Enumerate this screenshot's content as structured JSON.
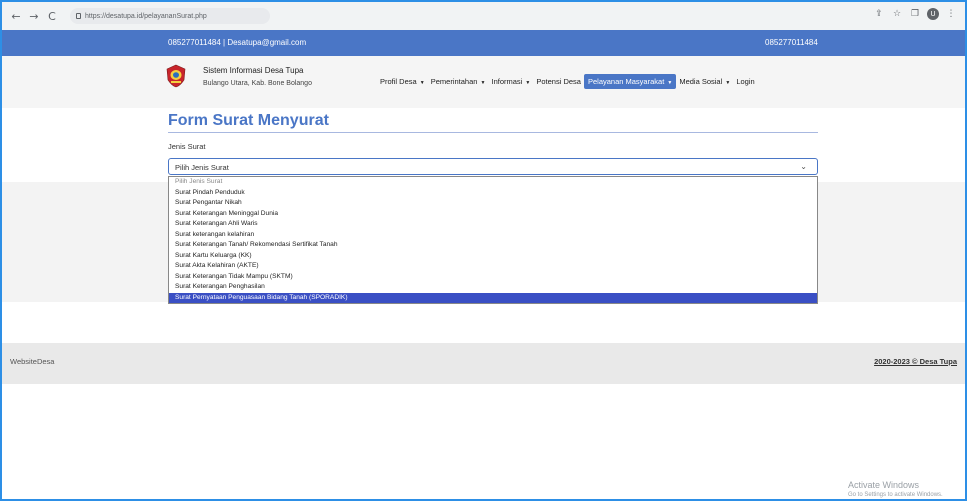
{
  "browser": {
    "url": "https://desatupa.id/pelayananSurat.php",
    "back": "←",
    "forward": "→",
    "reload": "C",
    "share_icon": "⇪",
    "star_icon": "☆",
    "window_icon": "❐",
    "profile_initial": "U",
    "more_icon": "⋮"
  },
  "topbar": {
    "contact": "085277011484 | Desatupa@gmail.com",
    "phone": "085277011484"
  },
  "header": {
    "title": "Sistem Informasi Desa Tupa",
    "subtitle": "Bulango Utara, Kab. Bone Bolango"
  },
  "menu": [
    {
      "label": "Profil Desa",
      "caret": "▼",
      "active": false
    },
    {
      "label": "Pemerintahan",
      "caret": "▼",
      "active": false
    },
    {
      "label": "Informasi",
      "caret": "▼",
      "active": false
    },
    {
      "label": "Potensi Desa",
      "caret": "",
      "active": false
    },
    {
      "label": "Pelayanan Masyarakat",
      "caret": "▼",
      "active": true
    },
    {
      "label": "Media Sosial",
      "caret": "▼",
      "active": false
    },
    {
      "label": "Login",
      "caret": "",
      "active": false
    }
  ],
  "form": {
    "title": "Form Surat Menyurat",
    "label": "Jenis Surat",
    "selected": "Pilih Jenis Surat",
    "chevron": "⌄"
  },
  "dropdown": {
    "options": [
      "Pilih Jenis Surat",
      "Surat Pindah Penduduk",
      "Surat Pengantar Nikah",
      "Surat Keterangan Meninggal Dunia",
      "Surat Keterangan Ahli Waris",
      "Surat keterangan kelahiran",
      "Surat Keterangan Tanah/ Rekomendasi Sertifikat Tanah",
      "Surat Kartu Keluarga (KK)",
      "Surat Akta Kelahiran (AKTE)",
      "Surat Keterangan Tidak Mampu (SKTM)",
      "Surat Keterangan Penghasilan",
      "Surat Pernyataan Penguasaan Bidang Tanah (SPORADIK)"
    ],
    "highlighted_index": 11
  },
  "footer": {
    "brand": "WebsiteDesa",
    "copyright": "2020-2023 © Desa Tupa"
  },
  "watermark": {
    "line1": "Activate Windows",
    "line2": "Go to Settings to activate Windows."
  },
  "colors": {
    "primary": "#4a76c6",
    "highlight": "#3a4fc4"
  }
}
